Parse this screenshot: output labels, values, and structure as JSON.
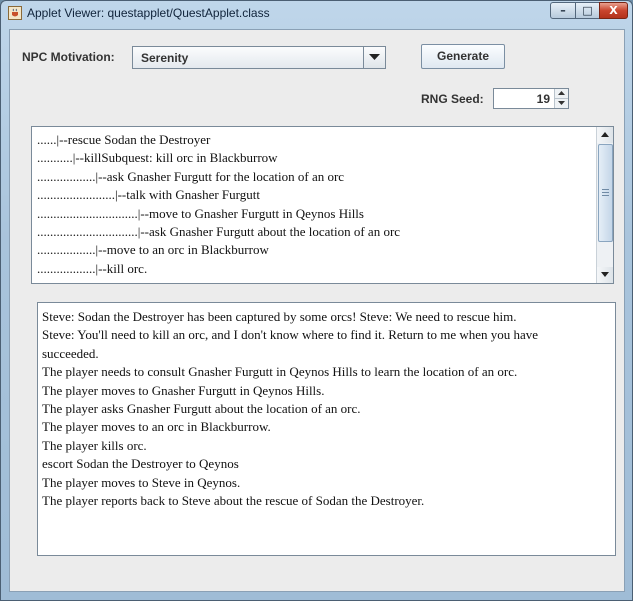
{
  "window": {
    "title": "Applet Viewer: questapplet/QuestApplet.class",
    "controls": {
      "minimize": "–",
      "maximize": "□",
      "close": "X"
    }
  },
  "form": {
    "npc_motivation_label": "NPC Motivation:",
    "npc_motivation_value": "Serenity",
    "generate_label": "Generate",
    "rng_seed_label": "RNG Seed:",
    "rng_seed_value": "19"
  },
  "quest_tree": {
    "lines": [
      "......|--rescue Sodan the Destroyer",
      "...........|--killSubquest: kill orc in Blackburrow",
      "..................|--ask Gnasher Furgutt for the location of an orc",
      "........................|--talk with Gnasher Furgutt",
      "...............................|--move to Gnasher Furgutt in Qeynos Hills",
      "...............................|--ask Gnasher Furgutt about the location of an orc",
      "..................|--move to an orc in Blackburrow",
      "..................|--kill orc."
    ]
  },
  "narrative": {
    "lines": [
      "Steve: Sodan the Destroyer has been captured by some orcs! Steve: We need to rescue him.",
      "Steve: You'll need to kill an orc, and I don't know where to find it. Return to me when you have",
      "succeeded.",
      "The player needs to consult Gnasher Furgutt in Qeynos Hills to learn the location of an orc.",
      "The player moves to Gnasher Furgutt in Qeynos Hills.",
      "The player asks Gnasher Furgutt about the location of an orc.",
      "The player moves to an orc in Blackburrow.",
      "The player kills orc.",
      "escort Sodan the Destroyer to Qeynos",
      "The player moves to Steve in Qeynos.",
      "The player reports back to Steve about the rescue of Sodan the Destroyer."
    ]
  },
  "icons": {
    "app": "java-applet-icon",
    "combo_arrow": "triangle-down-icon",
    "spin_up": "triangle-up-icon",
    "spin_down": "triangle-down-icon",
    "scroll_up": "triangle-up-icon",
    "scroll_down": "triangle-down-icon"
  },
  "colors": {
    "frame": "#a9c4dc",
    "panel": "#ececec",
    "close_button": "#c9452e"
  }
}
